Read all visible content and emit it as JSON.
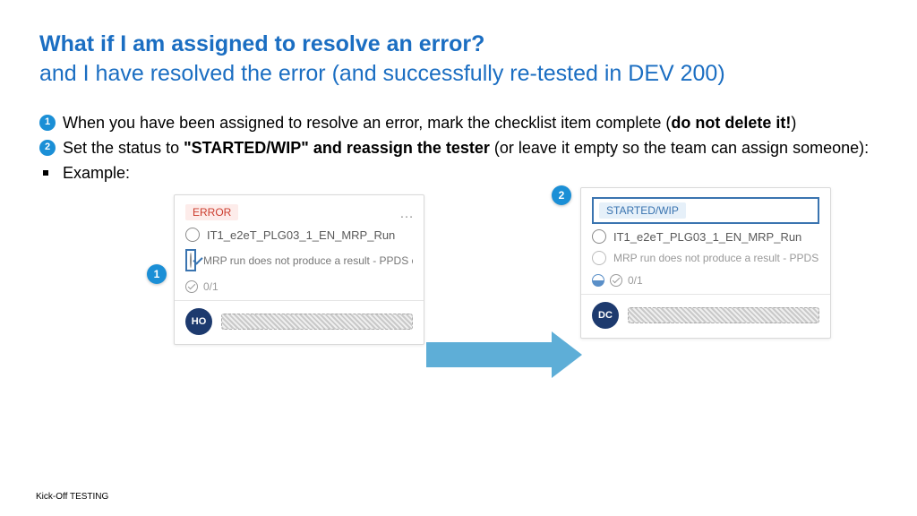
{
  "title": {
    "line1": "What if I am assigned to resolve an error?",
    "line2": " and I have resolved the error (and successfully re-tested in DEV 200)"
  },
  "bullets": {
    "b1_pre": "When you have been assigned to resolve an error, mark the checklist item complete (",
    "b1_bold": "do not delete it!",
    "b1_post": ")",
    "b2_pre": "Set the status to ",
    "b2_bold": "\"STARTED/WIP\" and reassign the tester",
    "b2_post": " (or leave it empty so the team can assign someone):",
    "b3": "Example:"
  },
  "badges": {
    "one": "1",
    "two": "2"
  },
  "card_left": {
    "tag": "ERROR",
    "menu_dots": "…",
    "task1": "IT1_e2eT_PLG03_1_EN_MRP_Run",
    "task2": "MRP run does not produce a result - PPDS ca",
    "counter": "0/1",
    "avatar": "HO"
  },
  "card_right": {
    "tag": "STARTED/WIP",
    "task1": "IT1_e2eT_PLG03_1_EN_MRP_Run",
    "task2": "MRP run does not produce a result - PPDS ca",
    "counter": "0/1",
    "avatar": "DC"
  },
  "footer": "Kick-Off TESTING"
}
